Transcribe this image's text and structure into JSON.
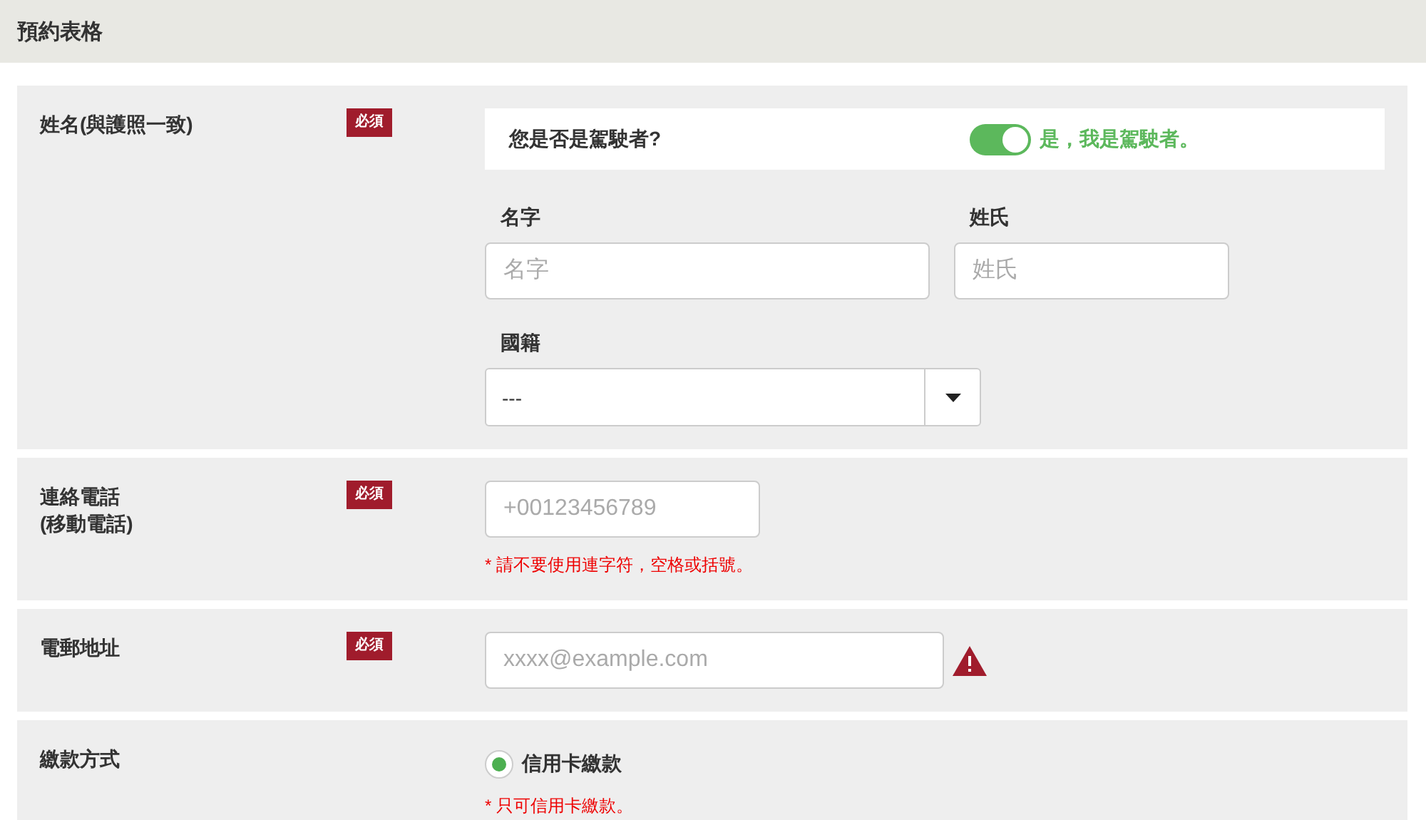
{
  "header": {
    "title": "預約表格"
  },
  "sections": [
    {
      "kind": "name",
      "label": [
        "姓名(與護照一致)"
      ],
      "badge": "必須",
      "driver": {
        "question": "您是否是駕駛者?",
        "on": true,
        "answer": "是，我是駕駛者。"
      },
      "first_name": {
        "label": "名字",
        "placeholder": "名字"
      },
      "last_name": {
        "label": "姓氏",
        "placeholder": "姓氏"
      },
      "nationality": {
        "label": "國籍",
        "value": "---"
      }
    },
    {
      "kind": "phone",
      "label": [
        "連絡電話",
        "(移動電話)"
      ],
      "badge": "必須",
      "field": {
        "placeholder": "+00123456789"
      },
      "note": "* 請不要使用連字符，空格或括號。"
    },
    {
      "kind": "email",
      "label": [
        "電郵地址"
      ],
      "badge": "必須",
      "field": {
        "placeholder": "xxxx@example.com"
      },
      "warning": true
    },
    {
      "kind": "payment",
      "label": [
        "繳款方式"
      ],
      "options": [
        {
          "label": "信用卡繳款",
          "selected": true
        }
      ],
      "note": "* 只可信用卡繳款。"
    }
  ]
}
